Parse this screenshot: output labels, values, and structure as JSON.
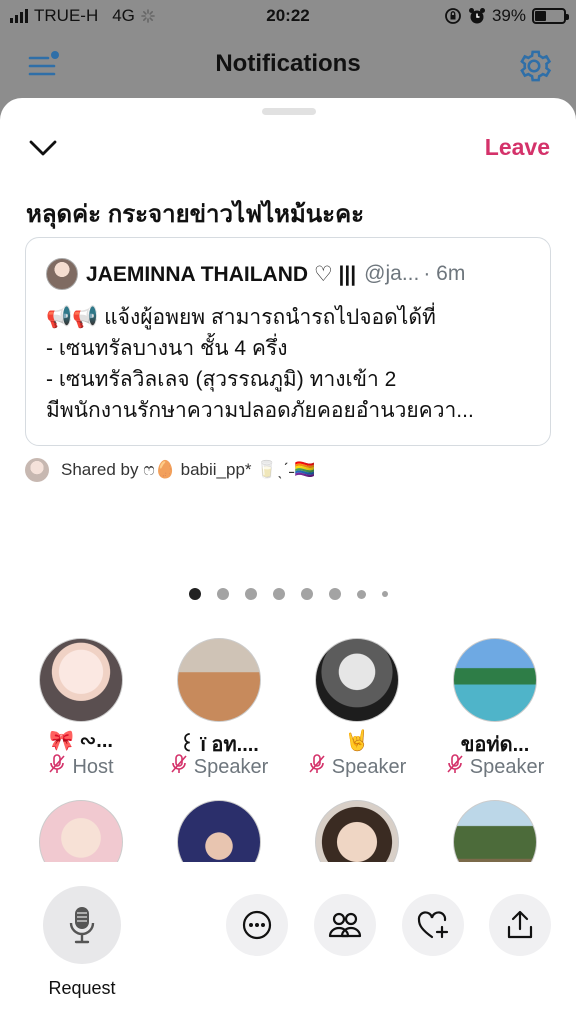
{
  "status_bar": {
    "carrier": "TRUE-H",
    "network": "4G",
    "time": "20:22",
    "battery": "39%",
    "battery_level": 0.39
  },
  "header": {
    "title": "Notifications"
  },
  "sheet": {
    "leave_label": "Leave",
    "space_title": "หลุดค่ะ กระจายข่าวไฟไหม้นะคะ",
    "tweet": {
      "author": "JAEMINNA THAILAND ♡ |||",
      "handle": "@ja...",
      "time": "· 6m",
      "lines": [
        "📢📢 แจ้งผู้อพยพ สามารถนำรถไปจอดได้ที่",
        "- เซนทรัลบางนา ชั้น 4 ครึ่ง",
        "- เซนทรัลวิลเลจ (สุวรรณภูมิ) ทางเข้า 2",
        "มีพนักงานรักษาความปลอดภัยคอยอำนวยควา..."
      ]
    },
    "shared_by": "Shared by ෆ🥚 babii_pp* 🥛ˎˊ˗🏳️‍🌈",
    "page_count": 8,
    "active_page": 1
  },
  "speakers": [
    {
      "name": "🎀 ∾...",
      "role": "Host"
    },
    {
      "name": "꒰ ï อท....",
      "role": "Speaker"
    },
    {
      "name": "🤘",
      "role": "Speaker"
    },
    {
      "name": "ขอท่ด...",
      "role": "Speaker"
    },
    {
      "name": "",
      "role": ""
    },
    {
      "name": "",
      "role": ""
    },
    {
      "name": "",
      "role": ""
    },
    {
      "name": "",
      "role": ""
    }
  ],
  "bottom_bar": {
    "request_label": "Request"
  },
  "colors": {
    "accent": "#d4326a",
    "icon_blue": "#1d9bf0"
  }
}
